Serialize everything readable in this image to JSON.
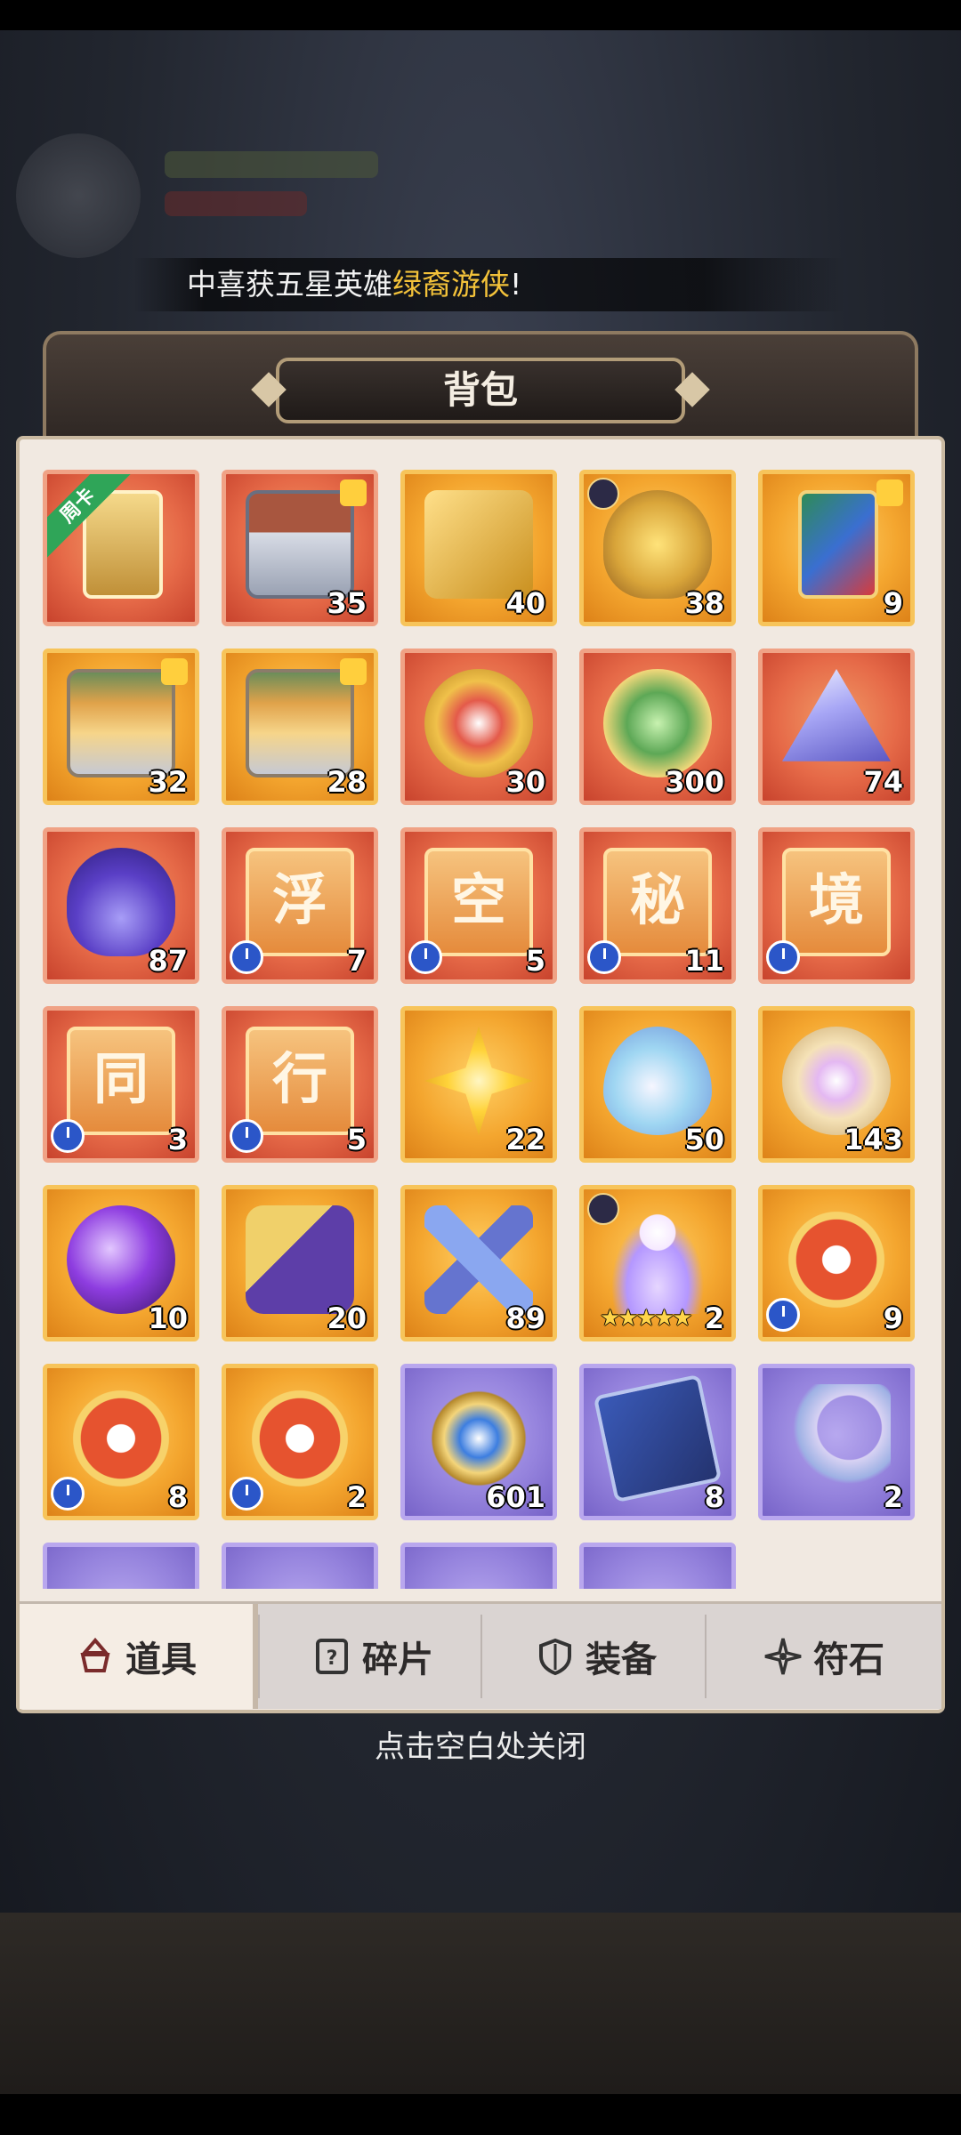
{
  "announcement": {
    "prefix": "中喜获五星英雄",
    "hero": "绿裔游侠",
    "suffix": "!"
  },
  "bag": {
    "title": "背包",
    "items": [
      {
        "count": "",
        "ribbon": "周卡"
      },
      {
        "count": "35"
      },
      {
        "count": "40"
      },
      {
        "count": "38"
      },
      {
        "count": "9"
      },
      {
        "count": "32"
      },
      {
        "count": "28"
      },
      {
        "count": "30"
      },
      {
        "count": "300"
      },
      {
        "count": "74"
      },
      {
        "count": "87"
      },
      {
        "count": "7",
        "glyph": "浮"
      },
      {
        "count": "5",
        "glyph": "空"
      },
      {
        "count": "11",
        "glyph": "秘"
      },
      {
        "count": "",
        "glyph": "境"
      },
      {
        "count": "3",
        "glyph": "同"
      },
      {
        "count": "5",
        "glyph": "行"
      },
      {
        "count": "22"
      },
      {
        "count": "50"
      },
      {
        "count": "143"
      },
      {
        "count": "10"
      },
      {
        "count": "20"
      },
      {
        "count": "89"
      },
      {
        "count": "2",
        "stars": "★★★★★"
      },
      {
        "count": "9"
      },
      {
        "count": "8"
      },
      {
        "count": "2"
      },
      {
        "count": "601"
      },
      {
        "count": "8"
      },
      {
        "count": "2"
      }
    ]
  },
  "tabs": [
    {
      "label": "道具",
      "icon": "items-icon",
      "active": true
    },
    {
      "label": "碎片",
      "icon": "fragment-icon",
      "active": false
    },
    {
      "label": "装备",
      "icon": "shield-icon",
      "active": false
    },
    {
      "label": "符石",
      "icon": "rune-icon",
      "active": false
    }
  ],
  "close_hint": "点击空白处关闭",
  "colors": {
    "cell_red": "#e66a48",
    "cell_gold": "#f4a62f",
    "cell_purple": "#9583dd",
    "highlight": "#f3c23a"
  }
}
